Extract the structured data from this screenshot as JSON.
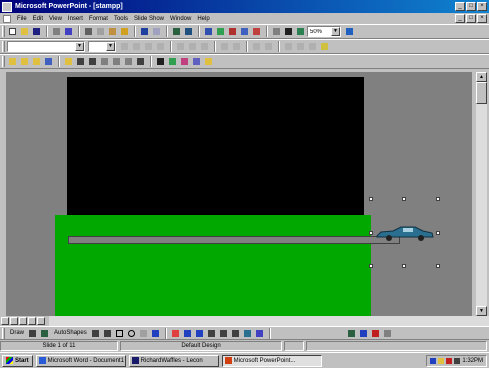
{
  "window": {
    "title": "Microsoft PowerPoint - [stampp]",
    "controls": [
      "_",
      "□",
      "×"
    ]
  },
  "menu": {
    "items": [
      "File",
      "Edit",
      "View",
      "Insert",
      "Format",
      "Tools",
      "Slide Show",
      "Window",
      "Help"
    ],
    "doc_controls": [
      "_",
      "□",
      "×"
    ]
  },
  "toolbar_standard": {
    "zoom": "50%"
  },
  "drawing_toolbar": {
    "draw_label": "Draw",
    "autoshapes_label": "AutoShapes"
  },
  "status": {
    "slide": "Slide 1 of 11",
    "design": "Default Design"
  },
  "taskbar": {
    "start_label": "Start",
    "tasks": [
      {
        "label": "Microsoft Word - Document1",
        "icon_color": "#2a5bd7"
      },
      {
        "label": "RichardWaffles - Lecon",
        "icon_color": "#1a1a6a"
      },
      {
        "label": "Microsoft PowerPoint...",
        "icon_color": "#d04010"
      }
    ],
    "clock": "1:32PM"
  },
  "slide": {
    "colors": {
      "sky": "#000000",
      "grass": "#00a800",
      "road": "#808080",
      "car": "#2a6f8f"
    }
  }
}
